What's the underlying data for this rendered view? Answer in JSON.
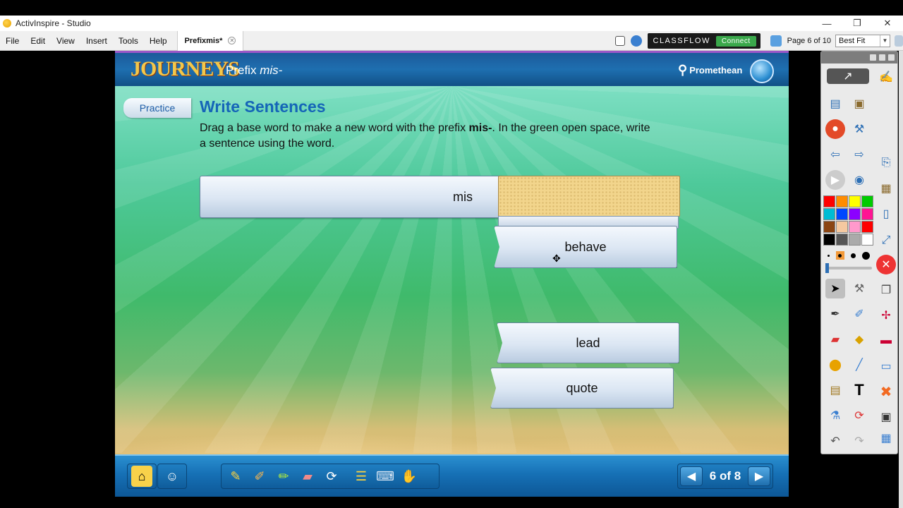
{
  "window": {
    "title": "ActivInspire - Studio",
    "minimize": "—",
    "maximize": "❐",
    "close": "✕"
  },
  "menubar": {
    "items": [
      "File",
      "Edit",
      "View",
      "Insert",
      "Tools",
      "Help"
    ],
    "doc_tab": "Prefixmis*",
    "classflow": "CLASSFLOW",
    "connect": "Connect",
    "page_of": "Page 6 of 10",
    "zoom": "Best Fit"
  },
  "stage": {
    "logo": "JOURNEYS",
    "lesson_prefix": "Prefix",
    "lesson_italic": "mis-",
    "brand": "Promethean",
    "tab_label": "Practice",
    "section_title": "Write Sentences",
    "instructions_pre": "Drag a base word to make a new word with the prefix ",
    "instructions_bold": "mis-",
    "instructions_post": ". In the green open space, write a sentence using the word.",
    "prefix": "mis",
    "words": [
      "behave",
      "lead",
      "quote"
    ],
    "pager": "6 of 8"
  },
  "icons": {
    "home": "house-icon",
    "student": "student-icon",
    "pen": "pen-icon",
    "highlighter": "highlighter-icon",
    "eraser": "eraser-icon",
    "reset": "refresh-icon",
    "notes": "notes-icon",
    "keyboard": "keyboard-icon",
    "hand": "hand-icon",
    "prev": "arrow-left-icon",
    "next": "arrow-right-icon"
  },
  "colors": {
    "header": "#1e6fb0",
    "title_blue": "#1565b8",
    "accent_purple": "#9c57c8",
    "sand": "#f2d58c",
    "connect_green": "#3aa84b"
  },
  "palette": [
    "#ff0000",
    "#ff8c00",
    "#ffff00",
    "#00cc00",
    "#00bcd4",
    "#0047ff",
    "#8b00ff",
    "#ff1493",
    "#8b4513",
    "#f5c9a0",
    "#ff99cc",
    "#ff0000",
    "#000000",
    "#555555",
    "#aaaaaa",
    "#ffffff"
  ]
}
